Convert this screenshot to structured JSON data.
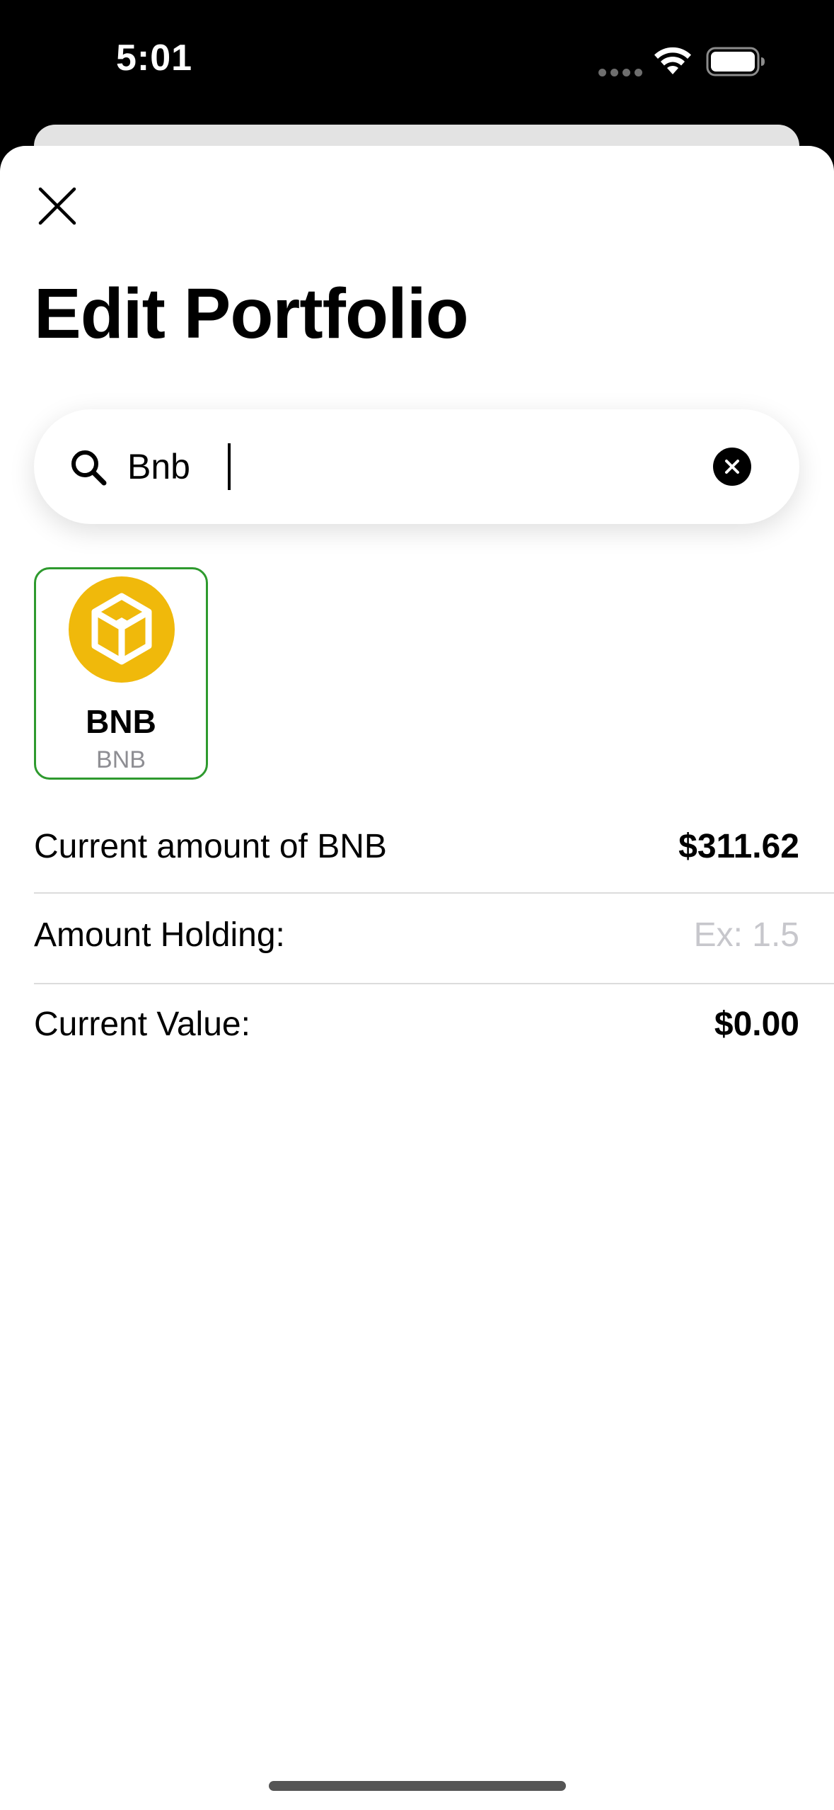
{
  "status_bar": {
    "time": "5:01",
    "icons": [
      "signal-dots-icon",
      "wifi-icon",
      "battery-icon"
    ]
  },
  "header": {
    "close_icon": "close-icon",
    "title": "Edit Portfolio"
  },
  "search": {
    "value": "Bnb",
    "icon": "search-icon",
    "clear_icon": "clear-icon"
  },
  "coins": [
    {
      "symbol": "BNB",
      "name": "BNB",
      "logo_icon": "bnb-logo-icon",
      "logo_color": "#F0B90B",
      "selected": true,
      "selected_border_color": "#2E9A2E"
    }
  ],
  "details": {
    "current_amount_label": "Current amount of BNB",
    "current_amount_value": "$311.62",
    "amount_holding_label": "Amount Holding:",
    "amount_holding_placeholder": "Ex: 1.5",
    "current_value_label": "Current Value:",
    "current_value_value": "$0.00"
  }
}
